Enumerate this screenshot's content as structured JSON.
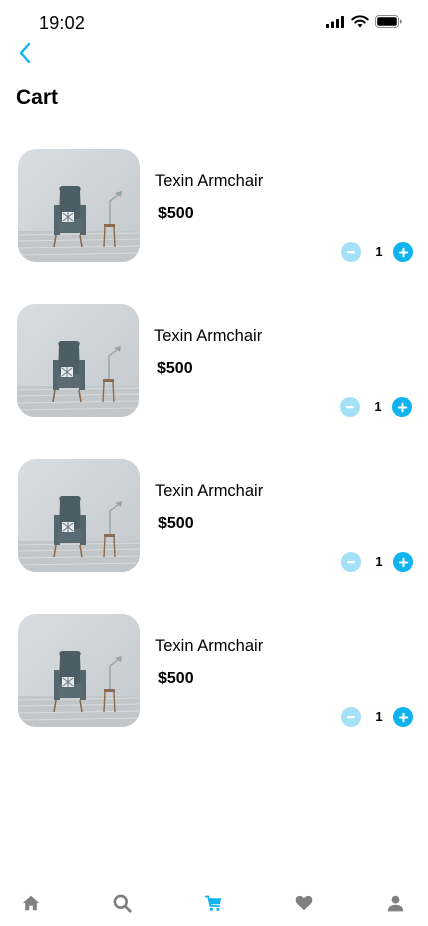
{
  "status_bar": {
    "time": "19:02"
  },
  "page": {
    "title": "Cart"
  },
  "cart": {
    "items": [
      {
        "name": "Texin Armchair",
        "price": "$500",
        "quantity": "1"
      },
      {
        "name": "Texin Armchair",
        "price": "$500",
        "quantity": "1"
      },
      {
        "name": "Texin Armchair",
        "price": "$500",
        "quantity": "1"
      },
      {
        "name": "Texin Armchair",
        "price": "$500",
        "quantity": "1"
      }
    ]
  },
  "tab_bar": {
    "tabs": [
      {
        "icon": "home-icon",
        "active": false
      },
      {
        "icon": "search-icon",
        "active": false
      },
      {
        "icon": "cart-icon",
        "active": true
      },
      {
        "icon": "heart-icon",
        "active": false
      },
      {
        "icon": "profile-icon",
        "active": false
      }
    ]
  },
  "colors": {
    "accent": "#10b3ee",
    "accent_light": "#a5e1f6",
    "icon_inactive": "#808080"
  }
}
